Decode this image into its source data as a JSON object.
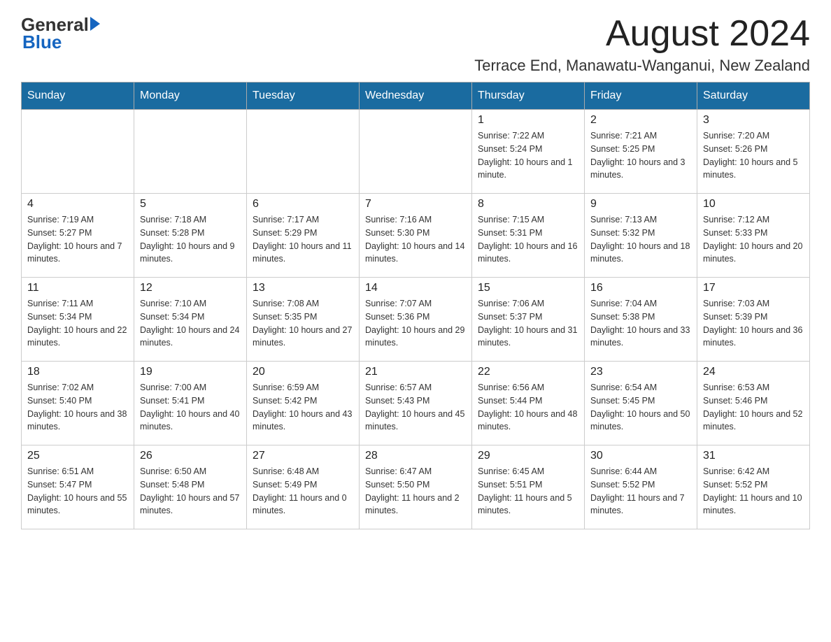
{
  "header": {
    "logo_general": "General",
    "logo_blue": "Blue",
    "month_title": "August 2024",
    "location": "Terrace End, Manawatu-Wanganui, New Zealand"
  },
  "weekdays": [
    "Sunday",
    "Monday",
    "Tuesday",
    "Wednesday",
    "Thursday",
    "Friday",
    "Saturday"
  ],
  "weeks": [
    [
      {
        "day": "",
        "info": ""
      },
      {
        "day": "",
        "info": ""
      },
      {
        "day": "",
        "info": ""
      },
      {
        "day": "",
        "info": ""
      },
      {
        "day": "1",
        "info": "Sunrise: 7:22 AM\nSunset: 5:24 PM\nDaylight: 10 hours and 1 minute."
      },
      {
        "day": "2",
        "info": "Sunrise: 7:21 AM\nSunset: 5:25 PM\nDaylight: 10 hours and 3 minutes."
      },
      {
        "day": "3",
        "info": "Sunrise: 7:20 AM\nSunset: 5:26 PM\nDaylight: 10 hours and 5 minutes."
      }
    ],
    [
      {
        "day": "4",
        "info": "Sunrise: 7:19 AM\nSunset: 5:27 PM\nDaylight: 10 hours and 7 minutes."
      },
      {
        "day": "5",
        "info": "Sunrise: 7:18 AM\nSunset: 5:28 PM\nDaylight: 10 hours and 9 minutes."
      },
      {
        "day": "6",
        "info": "Sunrise: 7:17 AM\nSunset: 5:29 PM\nDaylight: 10 hours and 11 minutes."
      },
      {
        "day": "7",
        "info": "Sunrise: 7:16 AM\nSunset: 5:30 PM\nDaylight: 10 hours and 14 minutes."
      },
      {
        "day": "8",
        "info": "Sunrise: 7:15 AM\nSunset: 5:31 PM\nDaylight: 10 hours and 16 minutes."
      },
      {
        "day": "9",
        "info": "Sunrise: 7:13 AM\nSunset: 5:32 PM\nDaylight: 10 hours and 18 minutes."
      },
      {
        "day": "10",
        "info": "Sunrise: 7:12 AM\nSunset: 5:33 PM\nDaylight: 10 hours and 20 minutes."
      }
    ],
    [
      {
        "day": "11",
        "info": "Sunrise: 7:11 AM\nSunset: 5:34 PM\nDaylight: 10 hours and 22 minutes."
      },
      {
        "day": "12",
        "info": "Sunrise: 7:10 AM\nSunset: 5:34 PM\nDaylight: 10 hours and 24 minutes."
      },
      {
        "day": "13",
        "info": "Sunrise: 7:08 AM\nSunset: 5:35 PM\nDaylight: 10 hours and 27 minutes."
      },
      {
        "day": "14",
        "info": "Sunrise: 7:07 AM\nSunset: 5:36 PM\nDaylight: 10 hours and 29 minutes."
      },
      {
        "day": "15",
        "info": "Sunrise: 7:06 AM\nSunset: 5:37 PM\nDaylight: 10 hours and 31 minutes."
      },
      {
        "day": "16",
        "info": "Sunrise: 7:04 AM\nSunset: 5:38 PM\nDaylight: 10 hours and 33 minutes."
      },
      {
        "day": "17",
        "info": "Sunrise: 7:03 AM\nSunset: 5:39 PM\nDaylight: 10 hours and 36 minutes."
      }
    ],
    [
      {
        "day": "18",
        "info": "Sunrise: 7:02 AM\nSunset: 5:40 PM\nDaylight: 10 hours and 38 minutes."
      },
      {
        "day": "19",
        "info": "Sunrise: 7:00 AM\nSunset: 5:41 PM\nDaylight: 10 hours and 40 minutes."
      },
      {
        "day": "20",
        "info": "Sunrise: 6:59 AM\nSunset: 5:42 PM\nDaylight: 10 hours and 43 minutes."
      },
      {
        "day": "21",
        "info": "Sunrise: 6:57 AM\nSunset: 5:43 PM\nDaylight: 10 hours and 45 minutes."
      },
      {
        "day": "22",
        "info": "Sunrise: 6:56 AM\nSunset: 5:44 PM\nDaylight: 10 hours and 48 minutes."
      },
      {
        "day": "23",
        "info": "Sunrise: 6:54 AM\nSunset: 5:45 PM\nDaylight: 10 hours and 50 minutes."
      },
      {
        "day": "24",
        "info": "Sunrise: 6:53 AM\nSunset: 5:46 PM\nDaylight: 10 hours and 52 minutes."
      }
    ],
    [
      {
        "day": "25",
        "info": "Sunrise: 6:51 AM\nSunset: 5:47 PM\nDaylight: 10 hours and 55 minutes."
      },
      {
        "day": "26",
        "info": "Sunrise: 6:50 AM\nSunset: 5:48 PM\nDaylight: 10 hours and 57 minutes."
      },
      {
        "day": "27",
        "info": "Sunrise: 6:48 AM\nSunset: 5:49 PM\nDaylight: 11 hours and 0 minutes."
      },
      {
        "day": "28",
        "info": "Sunrise: 6:47 AM\nSunset: 5:50 PM\nDaylight: 11 hours and 2 minutes."
      },
      {
        "day": "29",
        "info": "Sunrise: 6:45 AM\nSunset: 5:51 PM\nDaylight: 11 hours and 5 minutes."
      },
      {
        "day": "30",
        "info": "Sunrise: 6:44 AM\nSunset: 5:52 PM\nDaylight: 11 hours and 7 minutes."
      },
      {
        "day": "31",
        "info": "Sunrise: 6:42 AM\nSunset: 5:52 PM\nDaylight: 11 hours and 10 minutes."
      }
    ]
  ]
}
